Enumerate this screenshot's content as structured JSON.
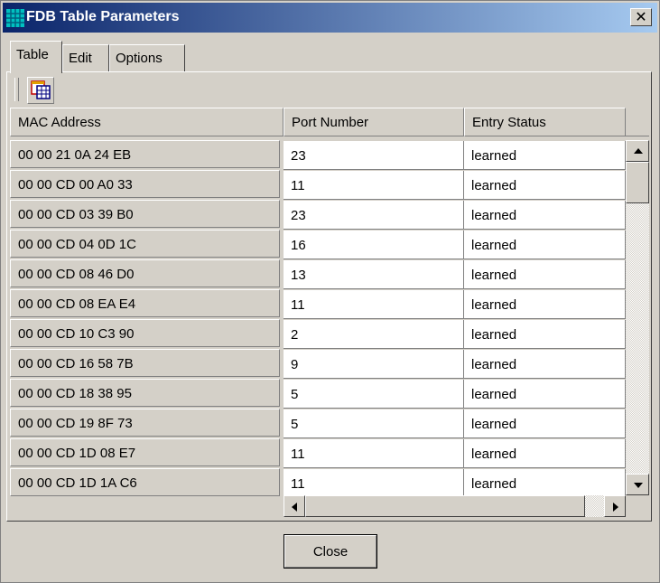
{
  "window": {
    "title": "FDB Table Parameters",
    "close_glyph": "✕",
    "icon": "grid-icon"
  },
  "tabs": [
    {
      "label": "Table",
      "active": true
    },
    {
      "label": "Edit",
      "active": false
    },
    {
      "label": "Options",
      "active": false
    }
  ],
  "toolbar": {
    "icon": "table-view-icon"
  },
  "table": {
    "columns": [
      "MAC Address",
      "Port Number",
      "Entry Status"
    ],
    "rows": [
      {
        "mac": "00 00 21 0A 24 EB",
        "port": "23",
        "status": "learned"
      },
      {
        "mac": "00 00 CD 00 A0 33",
        "port": "11",
        "status": "learned"
      },
      {
        "mac": "00 00 CD 03 39 B0",
        "port": "23",
        "status": "learned"
      },
      {
        "mac": "00 00 CD 04 0D 1C",
        "port": "16",
        "status": "learned"
      },
      {
        "mac": "00 00 CD 08 46 D0",
        "port": "13",
        "status": "learned"
      },
      {
        "mac": "00 00 CD 08 EA E4",
        "port": "11",
        "status": "learned"
      },
      {
        "mac": "00 00 CD 10 C3 90",
        "port": "2",
        "status": "learned"
      },
      {
        "mac": "00 00 CD 16 58 7B",
        "port": "9",
        "status": "learned"
      },
      {
        "mac": "00 00 CD 18 38 95",
        "port": "5",
        "status": "learned"
      },
      {
        "mac": "00 00 CD 19 8F 73",
        "port": "5",
        "status": "learned"
      },
      {
        "mac": "00 00 CD 1D 08 E7",
        "port": "11",
        "status": "learned"
      },
      {
        "mac": "00 00 CD 1D 1A C6",
        "port": "11",
        "status": "learned"
      }
    ]
  },
  "footer": {
    "close_label": "Close"
  }
}
